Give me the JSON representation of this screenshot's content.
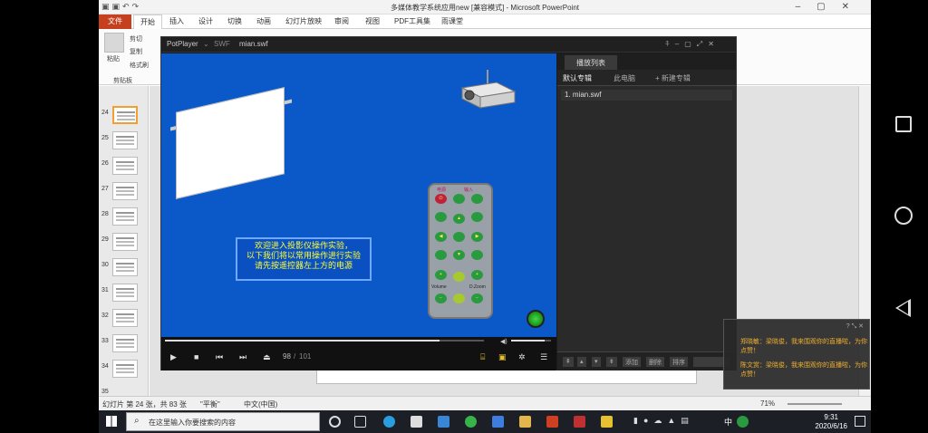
{
  "powerpoint": {
    "title": "多媒体教学系统应用new [兼容模式] - Microsoft PowerPoint",
    "tabs": [
      "文件",
      "开始",
      "插入",
      "设计",
      "切换",
      "动画",
      "幻灯片放映",
      "审阅",
      "视图",
      "PDF工具集",
      "雨课堂"
    ],
    "active_tab": "开始",
    "ribbon": {
      "paste": "粘贴",
      "cut": "剪切",
      "copy": "复制",
      "format_painter": "格式刷",
      "clipboard_group": "剪贴板"
    },
    "slide_numbers": [
      "24",
      "25",
      "26",
      "27",
      "28",
      "29",
      "30",
      "31",
      "32",
      "33",
      "34",
      "35"
    ],
    "selected_slide": "24",
    "status": {
      "slide_info": "幻灯片 第 24 张，共 83 张",
      "theme": "\"平衡\"",
      "language": "中文(中国)",
      "zoom": "71%"
    }
  },
  "potplayer": {
    "app_name": "PotPlayer",
    "format": "SWF",
    "filename": "mian.swf",
    "message_lines": [
      "欢迎进入投影仪操作实验，",
      "以下我们将以常用操作进行实验",
      "请先按遥控器左上方的电源"
    ],
    "remote_labels": {
      "power": "电源",
      "input": "输入",
      "volume": "Volume",
      "zoom": "D.Zoom"
    },
    "time": "98",
    "duration": "101",
    "progress": 0.86,
    "volume": 0.85,
    "playlist": {
      "tab": "播放列表",
      "subtabs": [
        "默认专辑",
        "此电脑",
        "+ 新建专辑"
      ],
      "items": [
        "1. mian.swf"
      ],
      "footer_buttons": [
        "添加",
        "删除",
        "排序"
      ]
    }
  },
  "taskbar": {
    "search_placeholder": "在这里输入你要搜索的内容",
    "time": "9:31",
    "date": "2020/6/16",
    "ime": "中"
  },
  "chat": {
    "messages": [
      "郑晓敏：梁晓俊，我来围观你的直播啦，为你点赞！",
      "陈文赏：梁晓俊，我来围观你的直播啦，为你点赞！"
    ]
  }
}
